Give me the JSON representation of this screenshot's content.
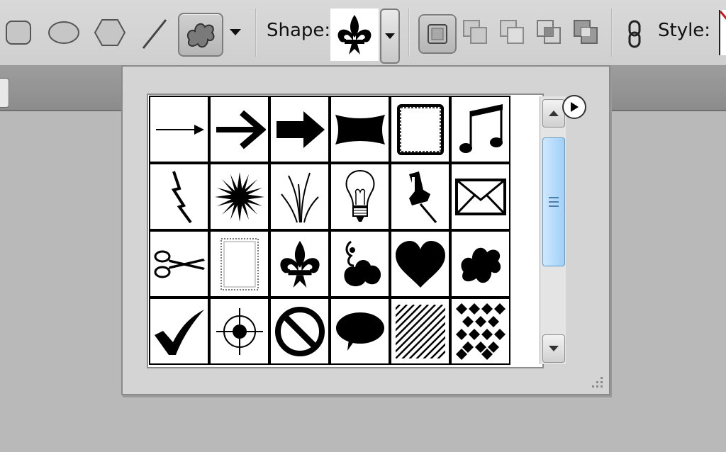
{
  "toolbar": {
    "shape_label": "Shape:",
    "style_label": "Style:",
    "tools": [
      {
        "name": "rounded-rectangle-tool",
        "icon": "rounded-rect-icon"
      },
      {
        "name": "ellipse-tool",
        "icon": "ellipse-icon"
      },
      {
        "name": "polygon-tool",
        "icon": "polygon-icon"
      },
      {
        "name": "line-tool",
        "icon": "line-icon"
      },
      {
        "name": "custom-shape-tool",
        "icon": "splat-icon",
        "selected": true
      }
    ],
    "current_shape_icon": "fleur-de-lis-icon",
    "path_mode_icons": [
      "new-layer-icon",
      "add-icon",
      "subtract-icon",
      "intersect-icon",
      "exclude-icon"
    ],
    "link_icon": "link-icon"
  },
  "shape_picker": {
    "menu_icon": "play-circle-icon",
    "shapes": [
      [
        "thin-arrow",
        "bold-arrow",
        "block-arrow",
        "banner",
        "frame",
        "music-note"
      ],
      [
        "lightning",
        "starburst",
        "grass",
        "lightbulb",
        "pushpin",
        "envelope"
      ],
      [
        "scissors",
        "stamp",
        "fleur-de-lis",
        "ornament",
        "heart",
        "splat"
      ],
      [
        "checkmark",
        "target",
        "no-sign",
        "speech-bubble",
        "hatching",
        "checkerboard"
      ]
    ]
  },
  "colors": {
    "accent": "#9fd0f7",
    "link_red": "#cc1b1b"
  }
}
